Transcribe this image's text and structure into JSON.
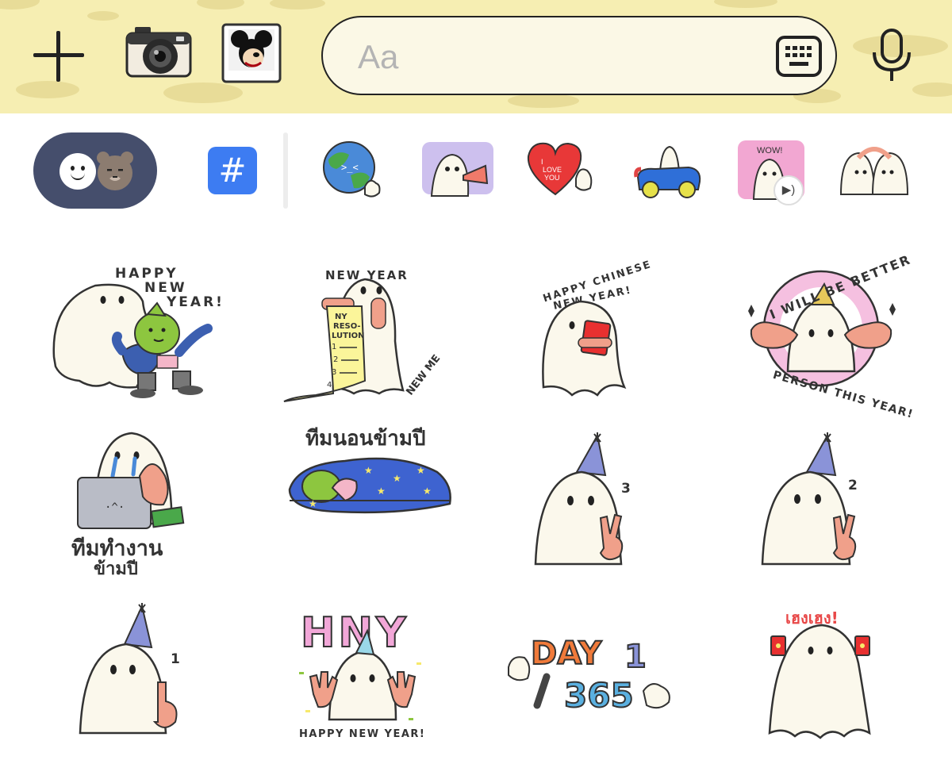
{
  "input_bar": {
    "placeholder": "Aa",
    "add_icon": "plus-icon",
    "camera_icon": "camera-icon",
    "photo_icon": "photo-icon",
    "keyboard_icon": "keyboard-icon",
    "mic_icon": "microphone-icon",
    "background_color": "#f6eeb2"
  },
  "sticker_tabs": {
    "hash_label": "#",
    "toggle_icons": [
      "smiley-icon",
      "bear-icon"
    ],
    "active_color": "#454e6c",
    "hash_color": "#3d7cf2"
  },
  "stickers": {
    "s1": {
      "l1": "HAPPY",
      "l2": "NEW",
      "l3": "YEAR!"
    },
    "s2": {
      "l1": "NEW YEAR",
      "l2": "NY",
      "l3": "RESO-",
      "l4": "LUTION",
      "l5": "NEW ME",
      "n1": "1",
      "n2": "2",
      "n3": "3",
      "n4": "4"
    },
    "s3": {
      "l1": "HAPPY CHINESE",
      "l2": "NEW YEAR!"
    },
    "s4": {
      "l1": "I WILL BE BETTER",
      "l2": "PERSON THIS YEAR!"
    },
    "s5": {
      "l1": "ทีมทำงาน",
      "l2": "ข้ามปี"
    },
    "s6": {
      "l1": "ทีมนอนข้ามปี"
    },
    "s7": {
      "n": "3"
    },
    "s8": {
      "n": "2"
    },
    "s9": {
      "n": "1"
    },
    "s10": {
      "l1": "HNY",
      "l2": "HAPPY NEW YEAR!"
    },
    "s11": {
      "l1": "DAY",
      "l2": "1",
      "l3": "365"
    },
    "s12": {
      "l1": "เฮงเฮง!"
    }
  }
}
